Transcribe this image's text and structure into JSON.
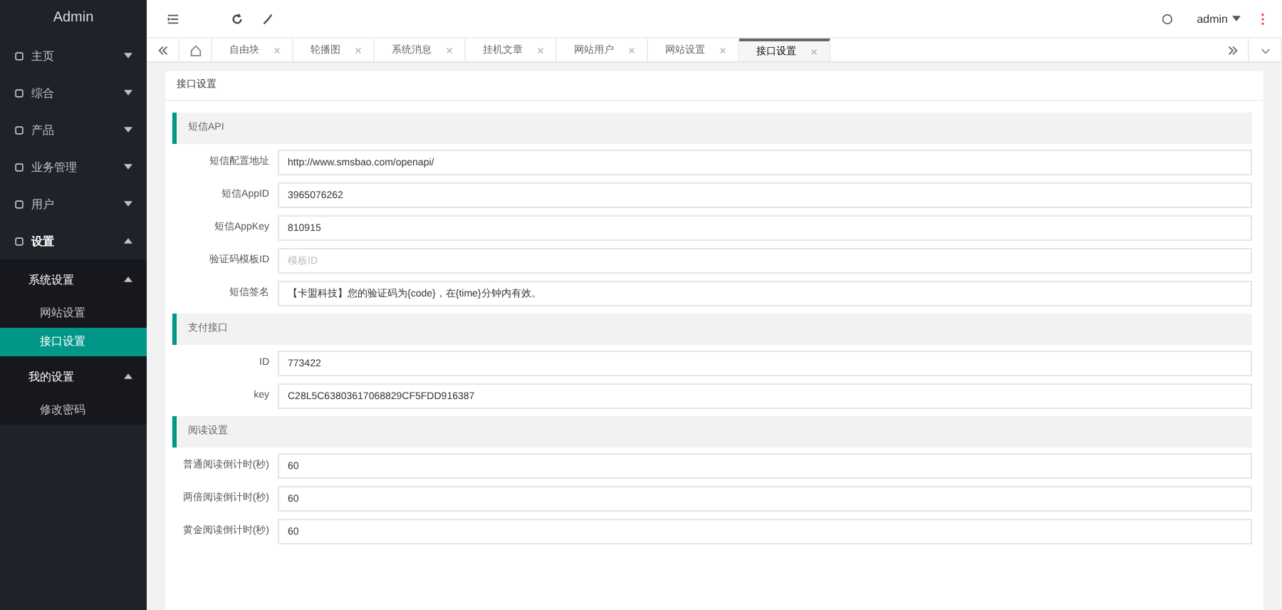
{
  "brand": "Admin",
  "sidebar": {
    "items": [
      {
        "label": "主页",
        "expanded": false
      },
      {
        "label": "综合",
        "expanded": false
      },
      {
        "label": "产品",
        "expanded": false
      },
      {
        "label": "业务管理",
        "expanded": false
      },
      {
        "label": "用户",
        "expanded": false
      },
      {
        "label": "设置",
        "expanded": true,
        "children": [
          {
            "label": "系统设置",
            "expanded": true,
            "selected": false,
            "children": [
              {
                "label": "网站设置",
                "selected": false
              },
              {
                "label": "接口设置",
                "selected": true
              }
            ]
          },
          {
            "label": "我的设置",
            "expanded": true,
            "selected": false,
            "children": [
              {
                "label": "修改密码",
                "selected": false
              }
            ]
          }
        ]
      }
    ]
  },
  "header": {
    "user": "admin"
  },
  "tabs": [
    {
      "label": "自由块",
      "selected": false
    },
    {
      "label": "轮播图",
      "selected": false
    },
    {
      "label": "系统消息",
      "selected": false
    },
    {
      "label": "挂机文章",
      "selected": false
    },
    {
      "label": "网站用户",
      "selected": false
    },
    {
      "label": "网站设置",
      "selected": false
    },
    {
      "label": "接口设置",
      "selected": true
    }
  ],
  "page_title": "接口设置",
  "sections": [
    {
      "title": "短信API",
      "fields": [
        {
          "label": "短信配置地址",
          "value": "http://www.smsbao.com/openapi/"
        },
        {
          "label": "短信AppID",
          "value": "3965076262"
        },
        {
          "label": "短信AppKey",
          "value": "810915"
        },
        {
          "label": "验证码模板ID",
          "placeholder": "模板ID"
        },
        {
          "label": "短信签名",
          "value": "【卡盟科技】您的验证码为{code}，在{time}分钟内有效。"
        }
      ]
    },
    {
      "title": "支付接口",
      "fields": [
        {
          "label": "ID",
          "value": "773422"
        },
        {
          "label": "key",
          "value": "C28L5C63803617068829CF5FDD916387"
        }
      ]
    },
    {
      "title": "阅读设置",
      "fields": [
        {
          "label": "普通阅读倒计时(秒)",
          "value": "60"
        },
        {
          "label": "两倍阅读倒计时(秒)",
          "value": "60"
        },
        {
          "label": "黄金阅读倒计时(秒)",
          "value": "60"
        }
      ]
    }
  ]
}
